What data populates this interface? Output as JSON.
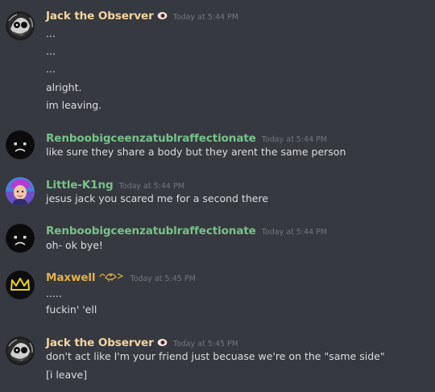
{
  "messages": [
    {
      "username": "Jack the Observer",
      "username_color": "#f3d5a2",
      "timestamp": "Today at 5:44 PM",
      "lines": [
        "...",
        "...",
        "...",
        "alright.",
        "im leaving."
      ]
    },
    {
      "username": "Renboobigceenzatublraffectionate",
      "username_color": "#77c28a",
      "timestamp": "Today at 5:44 PM",
      "lines": [
        "like sure they share a body but they arent the same person"
      ]
    },
    {
      "username": "Little-K1ng",
      "username_color": "#77c28a",
      "timestamp": "Today at 5:44 PM",
      "lines": [
        "jesus jack you scared me for a second there"
      ]
    },
    {
      "username": "Renboobigceenzatublraffectionate",
      "username_color": "#77c28a",
      "timestamp": "Today at 5:44 PM",
      "lines": [
        "oh- ok bye!"
      ]
    },
    {
      "username": "Maxwell",
      "username_color": "#e2b04a",
      "timestamp": "Today at 5:45 PM",
      "lines": [
        ".....",
        "fuckin' 'ell"
      ]
    },
    {
      "username": "Jack the Observer",
      "username_color": "#f3d5a2",
      "timestamp": "Today at 5:45 PM",
      "lines": [
        "don't act like I'm your friend just becuase we're on the \"same side\"",
        "[i leave]"
      ]
    }
  ],
  "badges": {
    "jack": "eye-icon",
    "maxwell": "dripping-eye-icon"
  },
  "colors": {
    "background": "#36393f",
    "text": "#dcddde",
    "timestamp": "#72767d"
  }
}
